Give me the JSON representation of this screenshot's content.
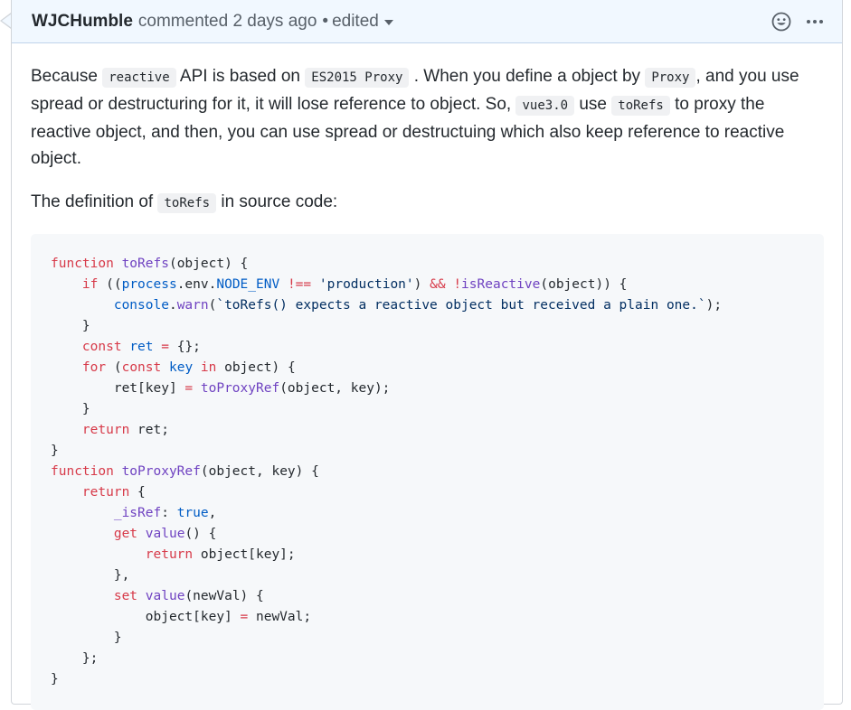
{
  "comment": {
    "author": "WJCHumble",
    "meta": "commented 2 days ago",
    "separator": "•",
    "edited_label": "edited",
    "icons": {
      "reaction": "smiley-icon",
      "more": "kebab-icon"
    }
  },
  "paragraphs": {
    "p1": {
      "t1": "Because",
      "c1": "reactive",
      "t2": "API is based on",
      "c2": "ES2015 Proxy",
      "t3": ". When you define a object by",
      "c3": "Proxy",
      "t4": ",  and you use spread or destructuring for it, it will lose reference to object. So,",
      "c4": "vue3.0",
      "t5": "use",
      "c5": "toRefs",
      "t6": "to proxy the reactive object, and then, you can use spread or destructuing which also keep reference to reactive object."
    },
    "p2": {
      "t1": "The definition of",
      "c1": "toRefs",
      "t2": "in source code:"
    }
  },
  "code_lines": [
    [
      [
        "kw",
        "function"
      ],
      [
        "pl",
        " "
      ],
      [
        "fn",
        "toRefs"
      ],
      [
        "pl",
        "(object) {"
      ]
    ],
    [
      [
        "pl",
        "    "
      ],
      [
        "kw",
        "if"
      ],
      [
        "pl",
        " (("
      ],
      [
        "cn",
        "process"
      ],
      [
        "pl",
        ".env."
      ],
      [
        "cn",
        "NODE_ENV"
      ],
      [
        "pl",
        " "
      ],
      [
        "kw",
        "!=="
      ],
      [
        "pl",
        " "
      ],
      [
        "st",
        "'production'"
      ],
      [
        "pl",
        ") "
      ],
      [
        "kw",
        "&&"
      ],
      [
        "pl",
        " "
      ],
      [
        "kw",
        "!"
      ],
      [
        "fn",
        "isReactive"
      ],
      [
        "pl",
        "(object)) {"
      ]
    ],
    [
      [
        "pl",
        "        "
      ],
      [
        "cn",
        "console"
      ],
      [
        "pl",
        "."
      ],
      [
        "fn",
        "warn"
      ],
      [
        "pl",
        "("
      ],
      [
        "st",
        "`toRefs() expects a reactive object but received a plain one.`"
      ],
      [
        "pl",
        ");"
      ]
    ],
    [
      [
        "pl",
        "    }"
      ]
    ],
    [
      [
        "pl",
        "    "
      ],
      [
        "kw",
        "const"
      ],
      [
        "pl",
        " "
      ],
      [
        "cn",
        "ret"
      ],
      [
        "pl",
        " "
      ],
      [
        "kw",
        "="
      ],
      [
        "pl",
        " {};"
      ]
    ],
    [
      [
        "pl",
        "    "
      ],
      [
        "kw",
        "for"
      ],
      [
        "pl",
        " ("
      ],
      [
        "kw",
        "const"
      ],
      [
        "pl",
        " "
      ],
      [
        "cn",
        "key"
      ],
      [
        "pl",
        " "
      ],
      [
        "kw",
        "in"
      ],
      [
        "pl",
        " object) {"
      ]
    ],
    [
      [
        "pl",
        "        ret[key] "
      ],
      [
        "kw",
        "="
      ],
      [
        "pl",
        " "
      ],
      [
        "fn",
        "toProxyRef"
      ],
      [
        "pl",
        "(object, key);"
      ]
    ],
    [
      [
        "pl",
        "    }"
      ]
    ],
    [
      [
        "pl",
        "    "
      ],
      [
        "kw",
        "return"
      ],
      [
        "pl",
        " ret;"
      ]
    ],
    [
      [
        "pl",
        "}"
      ]
    ],
    [
      [
        "kw",
        "function"
      ],
      [
        "pl",
        " "
      ],
      [
        "fn",
        "toProxyRef"
      ],
      [
        "pl",
        "(object, key) {"
      ]
    ],
    [
      [
        "pl",
        "    "
      ],
      [
        "kw",
        "return"
      ],
      [
        "pl",
        " {"
      ]
    ],
    [
      [
        "pl",
        "        "
      ],
      [
        "fn",
        "_isRef"
      ],
      [
        "pl",
        ": "
      ],
      [
        "cn",
        "true"
      ],
      [
        "pl",
        ","
      ]
    ],
    [
      [
        "pl",
        "        "
      ],
      [
        "kw",
        "get"
      ],
      [
        "pl",
        " "
      ],
      [
        "fn",
        "value"
      ],
      [
        "pl",
        "() {"
      ]
    ],
    [
      [
        "pl",
        "            "
      ],
      [
        "kw",
        "return"
      ],
      [
        "pl",
        " object[key];"
      ]
    ],
    [
      [
        "pl",
        "        },"
      ]
    ],
    [
      [
        "pl",
        "        "
      ],
      [
        "kw",
        "set"
      ],
      [
        "pl",
        " "
      ],
      [
        "fn",
        "value"
      ],
      [
        "pl",
        "(newVal) {"
      ]
    ],
    [
      [
        "pl",
        "            object[key] "
      ],
      [
        "kw",
        "="
      ],
      [
        "pl",
        " newVal;"
      ]
    ],
    [
      [
        "pl",
        "        }"
      ]
    ],
    [
      [
        "pl",
        "    };"
      ]
    ],
    [
      [
        "pl",
        "}"
      ]
    ]
  ]
}
